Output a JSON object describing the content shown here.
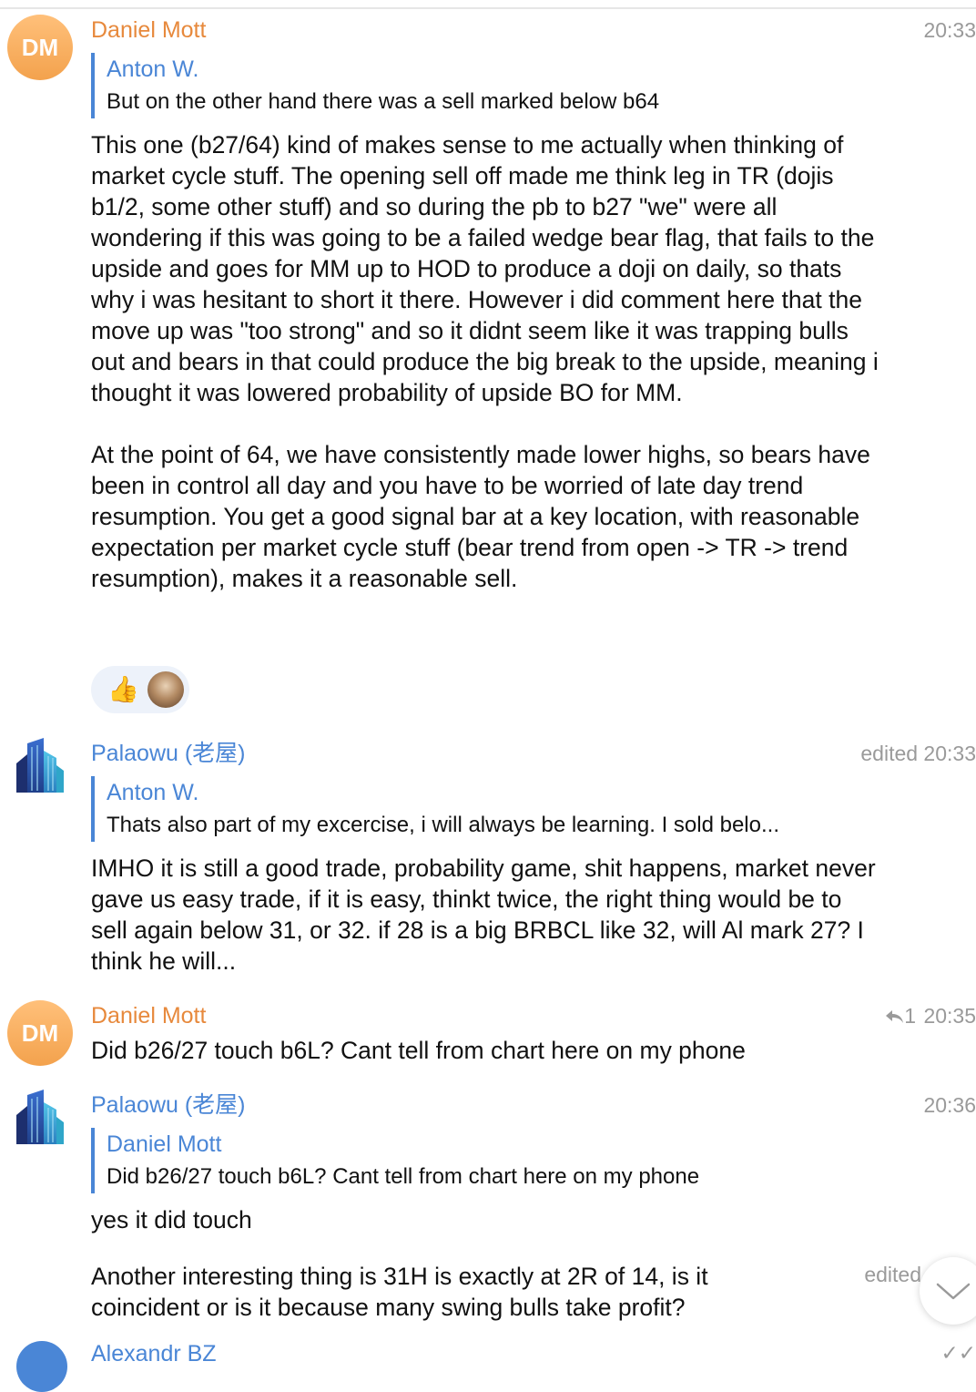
{
  "messages": [
    {
      "sender": "Daniel Mott",
      "avatar_initials": "DM",
      "time": "20:33",
      "reply_to": {
        "name": "Anton W.",
        "text": "But on the other hand there was a sell marked below b64"
      },
      "body": "This one (b27/64) kind of makes sense to me actually when thinking of market cycle stuff.  The opening sell off made me think leg in TR (dojis b1/2, some other stuff) and so during the pb to b27 \"we\" were all wondering if this was going to be a failed wedge bear flag, that fails to the upside and goes for MM up to HOD to produce a doji on daily, so thats why i was hesitant to short it there.  However i did comment here that the move up was \"too strong\" and so it didnt seem like it was trapping bulls out and bears in that could produce the big break to the upside, meaning i thought it was lowered probability of upside BO for MM.\n\nAt the point of 64, we have consistently made lower highs, so bears have been in control all day and you have to be worried of late day trend resumption.  You get a good signal bar at a key location, with reasonable expectation per market cycle stuff (bear trend from open -> TR -> trend resumption), makes it a reasonable sell.",
      "reaction": {
        "emoji": "👍"
      }
    },
    {
      "sender": "Palaowu (老屋)",
      "avatar_icon": "building-icon",
      "time": "edited 20:33",
      "reply_to": {
        "name": "Anton W.",
        "text": "Thats also part of my excercise, i will always be learning. I sold belo..."
      },
      "body": "IMHO it is still a good trade, probability game, shit happens, market never gave us easy trade, if it is easy, thinkt twice, the right thing would be to sell again below 31, or 32. if 28 is a big BRBCL like 32, will Al mark 27? I think he will..."
    },
    {
      "sender": "Daniel Mott",
      "avatar_initials": "DM",
      "reply_count": "1",
      "time": "20:35",
      "body": "Did b26/27 touch b6L? Cant tell from chart here on my phone"
    },
    {
      "sender": "Palaowu (老屋)",
      "avatar_icon": "building-icon",
      "time": "20:36",
      "reply_to": {
        "name": "Daniel Mott",
        "text": "Did b26/27 touch b6L? Cant tell from chart here on my phone"
      },
      "body": "yes it did touch",
      "followup": {
        "body": "Another interesting thing is 31H is exactly at 2R of 14, is it coincident or is it because many swing bulls take profit?",
        "time": "edited"
      }
    }
  ],
  "partial_next": {
    "sender": "Alexandr BZ"
  },
  "colors": {
    "name_orange": "#e7893c",
    "name_blue": "#4a86d6",
    "meta_gray": "#9a9a9a",
    "reaction_bg": "#edf2fa"
  },
  "icons": {
    "reply": "reply-arrow-icon",
    "scroll_down": "chevron-down-icon",
    "read": "double-check-icon"
  }
}
